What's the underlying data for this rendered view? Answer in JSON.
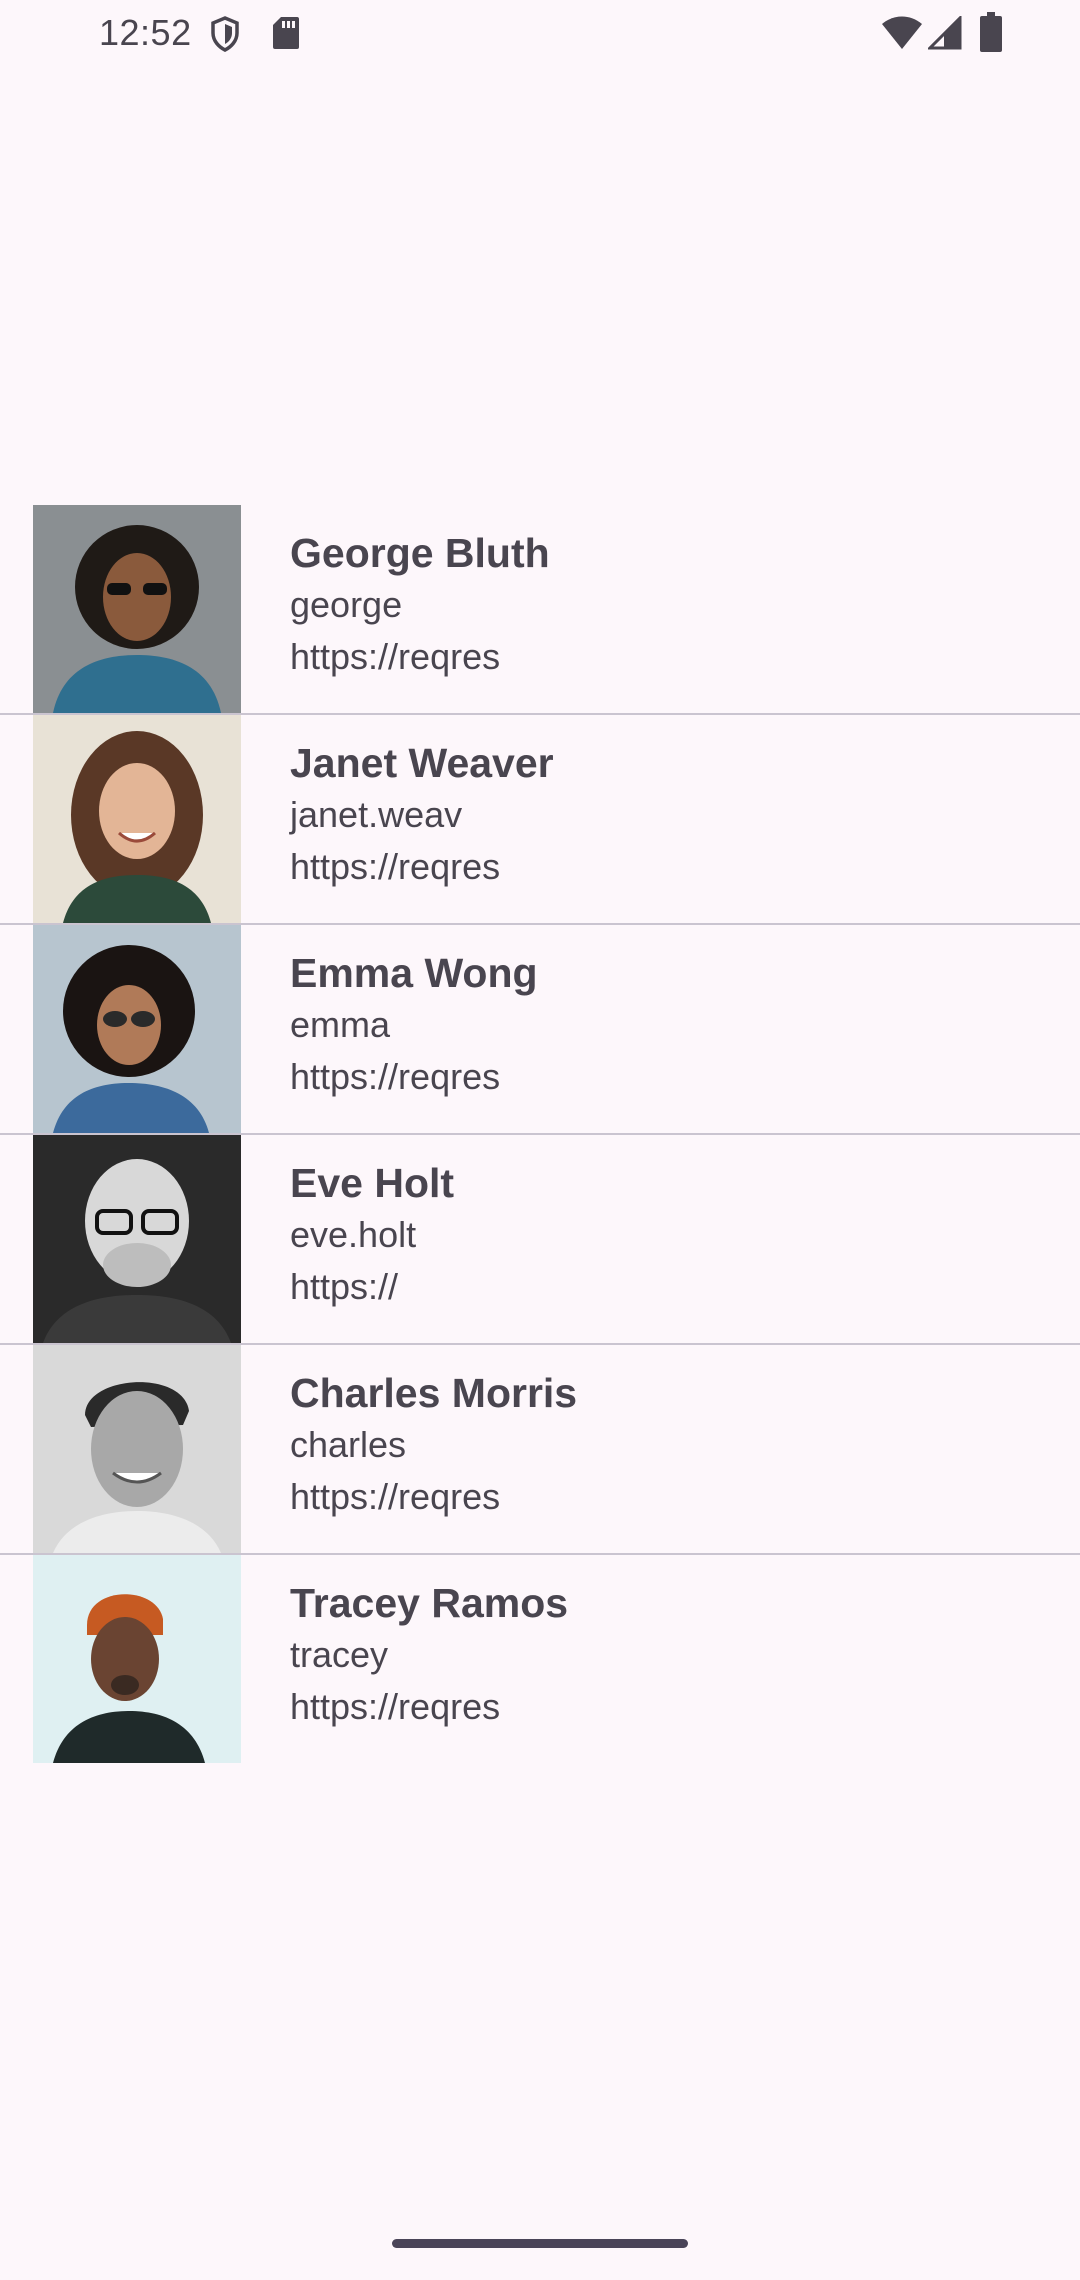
{
  "status_bar": {
    "time": "12:52",
    "icons": [
      "shield-icon",
      "sd-card-icon",
      "wifi-icon",
      "cellular-signal-icon",
      "battery-icon"
    ]
  },
  "users": [
    {
      "name": "George Bluth",
      "username": "george",
      "url": "https://reqres",
      "avatar_bg": "#8a8f92",
      "shirt": "#2f6f8f"
    },
    {
      "name": "Janet Weaver",
      "username": "janet.weav",
      "url": "https://reqres",
      "avatar_bg": "#e8e2d6",
      "shirt": "#2c4a3a"
    },
    {
      "name": "Emma Wong",
      "username": "emma",
      "url": "https://reqres",
      "avatar_bg": "#b7c5cf",
      "shirt": "#3c6a9c"
    },
    {
      "name": "Eve Holt",
      "username": "eve.holt",
      "url": "https://",
      "avatar_bg": "#2a2a2a",
      "shirt": "#3a3a3a"
    },
    {
      "name": "Charles Morris",
      "username": "charles",
      "url": "https://reqres",
      "avatar_bg": "#d9d9d9",
      "shirt": "#ececec"
    },
    {
      "name": "Tracey Ramos",
      "username": "tracey",
      "url": "https://reqres",
      "avatar_bg": "#dff0f2",
      "shirt": "#1f2a2a"
    }
  ],
  "colors": {
    "background": "#fdf7fb",
    "text": "#49454f",
    "divider": "#cac4d0"
  }
}
